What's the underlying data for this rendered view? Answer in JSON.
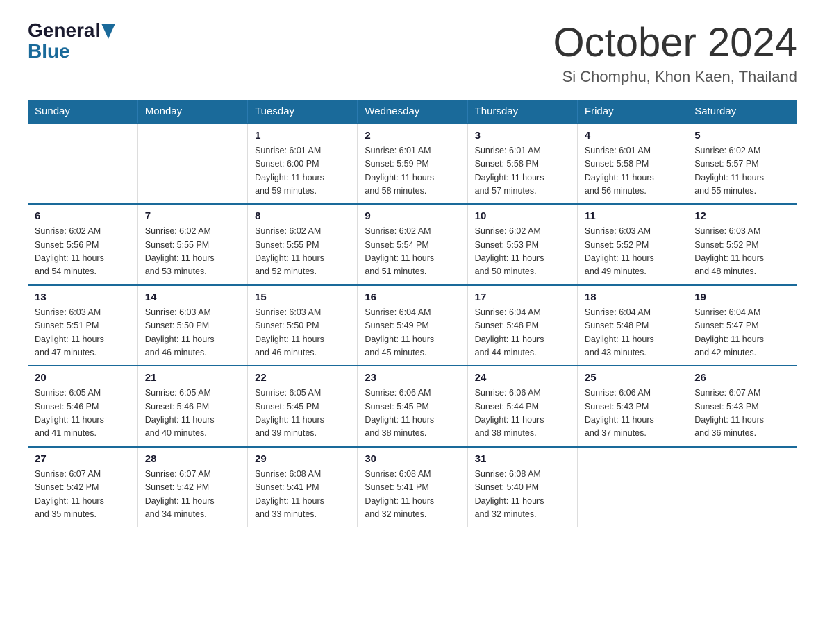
{
  "logo": {
    "general": "General",
    "blue": "Blue",
    "triangle_color": "#1a6a9a"
  },
  "title": "October 2024",
  "subtitle": "Si Chomphu, Khon Kaen, Thailand",
  "days_of_week": [
    "Sunday",
    "Monday",
    "Tuesday",
    "Wednesday",
    "Thursday",
    "Friday",
    "Saturday"
  ],
  "weeks": [
    [
      {
        "day": "",
        "info": ""
      },
      {
        "day": "",
        "info": ""
      },
      {
        "day": "1",
        "info": "Sunrise: 6:01 AM\nSunset: 6:00 PM\nDaylight: 11 hours\nand 59 minutes."
      },
      {
        "day": "2",
        "info": "Sunrise: 6:01 AM\nSunset: 5:59 PM\nDaylight: 11 hours\nand 58 minutes."
      },
      {
        "day": "3",
        "info": "Sunrise: 6:01 AM\nSunset: 5:58 PM\nDaylight: 11 hours\nand 57 minutes."
      },
      {
        "day": "4",
        "info": "Sunrise: 6:01 AM\nSunset: 5:58 PM\nDaylight: 11 hours\nand 56 minutes."
      },
      {
        "day": "5",
        "info": "Sunrise: 6:02 AM\nSunset: 5:57 PM\nDaylight: 11 hours\nand 55 minutes."
      }
    ],
    [
      {
        "day": "6",
        "info": "Sunrise: 6:02 AM\nSunset: 5:56 PM\nDaylight: 11 hours\nand 54 minutes."
      },
      {
        "day": "7",
        "info": "Sunrise: 6:02 AM\nSunset: 5:55 PM\nDaylight: 11 hours\nand 53 minutes."
      },
      {
        "day": "8",
        "info": "Sunrise: 6:02 AM\nSunset: 5:55 PM\nDaylight: 11 hours\nand 52 minutes."
      },
      {
        "day": "9",
        "info": "Sunrise: 6:02 AM\nSunset: 5:54 PM\nDaylight: 11 hours\nand 51 minutes."
      },
      {
        "day": "10",
        "info": "Sunrise: 6:02 AM\nSunset: 5:53 PM\nDaylight: 11 hours\nand 50 minutes."
      },
      {
        "day": "11",
        "info": "Sunrise: 6:03 AM\nSunset: 5:52 PM\nDaylight: 11 hours\nand 49 minutes."
      },
      {
        "day": "12",
        "info": "Sunrise: 6:03 AM\nSunset: 5:52 PM\nDaylight: 11 hours\nand 48 minutes."
      }
    ],
    [
      {
        "day": "13",
        "info": "Sunrise: 6:03 AM\nSunset: 5:51 PM\nDaylight: 11 hours\nand 47 minutes."
      },
      {
        "day": "14",
        "info": "Sunrise: 6:03 AM\nSunset: 5:50 PM\nDaylight: 11 hours\nand 46 minutes."
      },
      {
        "day": "15",
        "info": "Sunrise: 6:03 AM\nSunset: 5:50 PM\nDaylight: 11 hours\nand 46 minutes."
      },
      {
        "day": "16",
        "info": "Sunrise: 6:04 AM\nSunset: 5:49 PM\nDaylight: 11 hours\nand 45 minutes."
      },
      {
        "day": "17",
        "info": "Sunrise: 6:04 AM\nSunset: 5:48 PM\nDaylight: 11 hours\nand 44 minutes."
      },
      {
        "day": "18",
        "info": "Sunrise: 6:04 AM\nSunset: 5:48 PM\nDaylight: 11 hours\nand 43 minutes."
      },
      {
        "day": "19",
        "info": "Sunrise: 6:04 AM\nSunset: 5:47 PM\nDaylight: 11 hours\nand 42 minutes."
      }
    ],
    [
      {
        "day": "20",
        "info": "Sunrise: 6:05 AM\nSunset: 5:46 PM\nDaylight: 11 hours\nand 41 minutes."
      },
      {
        "day": "21",
        "info": "Sunrise: 6:05 AM\nSunset: 5:46 PM\nDaylight: 11 hours\nand 40 minutes."
      },
      {
        "day": "22",
        "info": "Sunrise: 6:05 AM\nSunset: 5:45 PM\nDaylight: 11 hours\nand 39 minutes."
      },
      {
        "day": "23",
        "info": "Sunrise: 6:06 AM\nSunset: 5:45 PM\nDaylight: 11 hours\nand 38 minutes."
      },
      {
        "day": "24",
        "info": "Sunrise: 6:06 AM\nSunset: 5:44 PM\nDaylight: 11 hours\nand 38 minutes."
      },
      {
        "day": "25",
        "info": "Sunrise: 6:06 AM\nSunset: 5:43 PM\nDaylight: 11 hours\nand 37 minutes."
      },
      {
        "day": "26",
        "info": "Sunrise: 6:07 AM\nSunset: 5:43 PM\nDaylight: 11 hours\nand 36 minutes."
      }
    ],
    [
      {
        "day": "27",
        "info": "Sunrise: 6:07 AM\nSunset: 5:42 PM\nDaylight: 11 hours\nand 35 minutes."
      },
      {
        "day": "28",
        "info": "Sunrise: 6:07 AM\nSunset: 5:42 PM\nDaylight: 11 hours\nand 34 minutes."
      },
      {
        "day": "29",
        "info": "Sunrise: 6:08 AM\nSunset: 5:41 PM\nDaylight: 11 hours\nand 33 minutes."
      },
      {
        "day": "30",
        "info": "Sunrise: 6:08 AM\nSunset: 5:41 PM\nDaylight: 11 hours\nand 32 minutes."
      },
      {
        "day": "31",
        "info": "Sunrise: 6:08 AM\nSunset: 5:40 PM\nDaylight: 11 hours\nand 32 minutes."
      },
      {
        "day": "",
        "info": ""
      },
      {
        "day": "",
        "info": ""
      }
    ]
  ]
}
